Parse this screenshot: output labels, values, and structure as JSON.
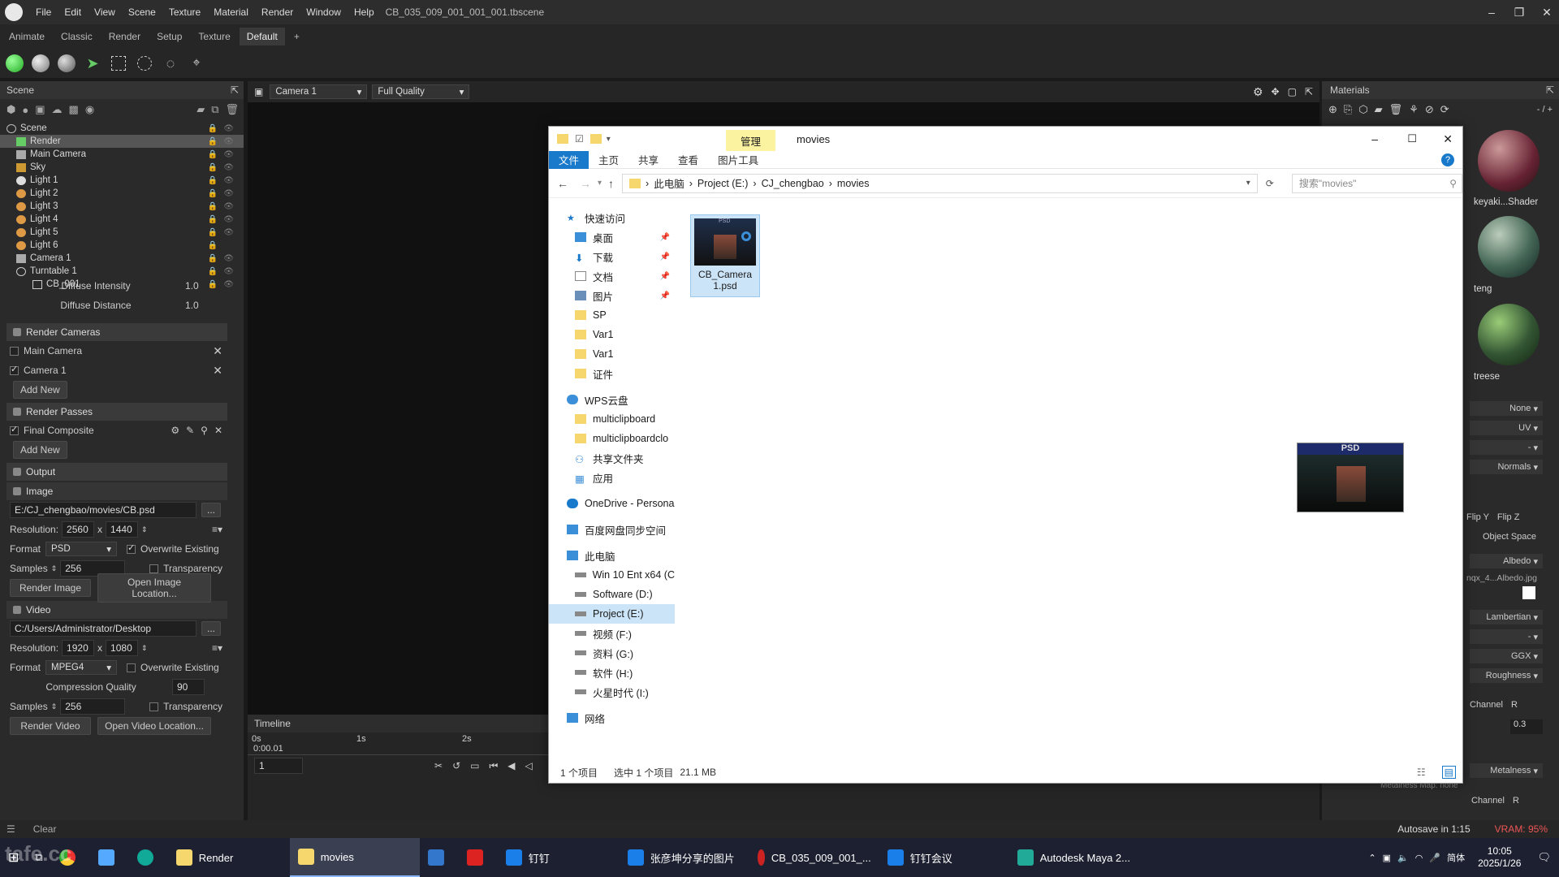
{
  "app": {
    "menu": [
      "File",
      "Edit",
      "View",
      "Scene",
      "Texture",
      "Material",
      "Render",
      "Window",
      "Help"
    ],
    "title": "CB_035_009_001_001_001.tbscene"
  },
  "tabs": [
    "Animate",
    "Classic",
    "Render",
    "Setup",
    "Texture",
    "Default",
    "+"
  ],
  "scene_panel": {
    "header": "Scene",
    "tree": [
      "Scene",
      "Render",
      "Main Camera",
      "Sky",
      "Light 1",
      "Light 2",
      "Light 3",
      "Light 4",
      "Light 5",
      "Light 6",
      "Camera 1",
      "Turntable 1",
      "CB_001"
    ],
    "diffuse_intensity_label": "Diffuse Intensity",
    "diffuse_intensity": "1.0",
    "diffuse_distance_label": "Diffuse Distance",
    "diffuse_distance": "1.0",
    "render_cameras": "Render Cameras",
    "cam_main": "Main Camera",
    "cam_1": "Camera 1",
    "add_new": "Add New",
    "render_passes": "Render Passes",
    "final_composite": "Final Composite",
    "output": "Output",
    "image": "Image",
    "image_path": "E:/CJ_chengbao/movies/CB.psd",
    "dots": "...",
    "resolution_label": "Resolution:",
    "x": "x",
    "img_w": "2560",
    "img_h": "1440",
    "format_label": "Format",
    "img_format": "PSD",
    "overwrite": "Overwrite Existing",
    "samples_label": "Samples",
    "img_samples": "256",
    "transparency": "Transparency",
    "render_image": "Render Image",
    "open_image_loc": "Open Image Location...",
    "video": "Video",
    "video_path": "C:/Users/Administrator/Desktop",
    "vid_w": "1920",
    "vid_h": "1080",
    "vid_format": "MPEG4",
    "compression": "Compression Quality",
    "compression_val": "90",
    "vid_samples": "256",
    "render_video": "Render Video",
    "open_video_loc": "Open Video Location..."
  },
  "viewport": {
    "camera": "Camera 1",
    "quality": "Full Quality"
  },
  "timeline": {
    "label": "Timeline",
    "t0": "0s",
    "t1": "1s",
    "t2": "2s",
    "time": "0:00.01",
    "frame": "1"
  },
  "materials": {
    "header": "Materials",
    "counter": "- / +",
    "mat1": "keyaki...Shader",
    "mat2": "teng",
    "mat3": "treese",
    "p_none": "None",
    "p_uv": "UV",
    "p_dash": "-",
    "p_normals": "Normals",
    "flip_y": "Flip Y",
    "flip_z": "Flip Z",
    "object_space": "Object Space",
    "albedo": "Albedo",
    "albedo_map": "nqx_4...Albedo.jpg",
    "lambertian": "Lambertian",
    "ggx": "GGX",
    "roughness": "Roughness",
    "channel": "Channel",
    "channel_r": "R",
    "rough_val": "0.3",
    "metalness": "Metalness",
    "metal_map": "Metalness Map: none"
  },
  "status": {
    "clear": "Clear",
    "autosave": "Autosave in 1:15",
    "vram": "VRAM: 95%"
  },
  "explorer": {
    "manage": "管理",
    "title": "movies",
    "ribbon": [
      "文件",
      "主页",
      "共享",
      "查看",
      "图片工具"
    ],
    "crumbs": [
      "此电脑",
      "Project (E:)",
      "CJ_chengbao",
      "movies"
    ],
    "search_placeholder": "搜索\"movies\"",
    "nav": [
      "快速访问",
      "桌面",
      "下载",
      "文档",
      "图片",
      "SP",
      "Var1",
      "Var1",
      "证件",
      "WPS云盘",
      "multiclipboard",
      "multiclipboardclo",
      "共享文件夹",
      "应用",
      "OneDrive - Persona",
      "百度网盘同步空间",
      "此电脑",
      "Win 10 Ent x64 (C",
      "Software (D:)",
      "Project (E:)",
      "视频 (F:)",
      "资料 (G:)",
      "软件 (H:)",
      "火星时代 (I:)",
      "网络"
    ],
    "file_line1": "CB_Camera",
    "file_line2": "1.psd",
    "file_badge": "PSD",
    "preview_badge": "PSD",
    "status_count": "1 个项目",
    "status_sel": "选中 1 个项目",
    "status_size": "21.1 MB"
  },
  "taskbar": {
    "items": [
      "Render",
      "movies",
      "钉钉",
      "张彦坤分享的图片",
      "CB_035_009_001_...",
      "钉钉会议",
      "Autodesk Maya 2..."
    ],
    "ime": "简体",
    "time": "10:05",
    "date": "2025/1/26",
    "watermark": "tafe.cc"
  }
}
